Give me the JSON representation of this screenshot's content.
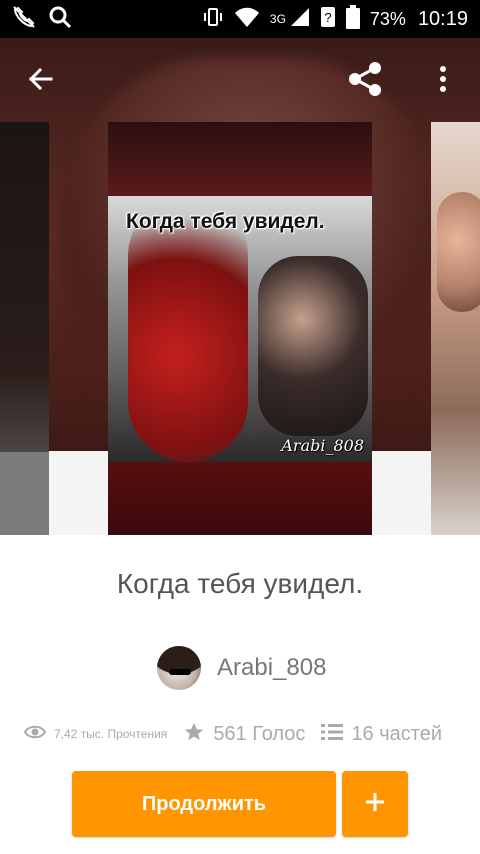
{
  "status_bar": {
    "battery": "73%",
    "time": "10:19",
    "network": "3G",
    "icons": [
      "phone-off-icon",
      "search-icon",
      "vibrate-icon",
      "wifi-icon",
      "signal-icon",
      "sim-unknown-icon",
      "battery-icon"
    ]
  },
  "top_bar": {
    "icons": [
      "back-arrow-icon",
      "share-icon",
      "more-vert-icon"
    ]
  },
  "cover": {
    "caption": "Когда тебя увидел.",
    "watermark": "Arabi_808"
  },
  "story": {
    "title": "Когда тебя увидел.",
    "author": "Arabi_808",
    "reads": "7,42 тыс. Прочтения",
    "votes": "561 Голос",
    "parts": "16 частей"
  },
  "actions": {
    "continue_label": "Продолжить",
    "add_label": "+"
  },
  "colors": {
    "accent": "#ff9500",
    "text_dark": "#555555",
    "text_muted": "#aaaaaa"
  }
}
